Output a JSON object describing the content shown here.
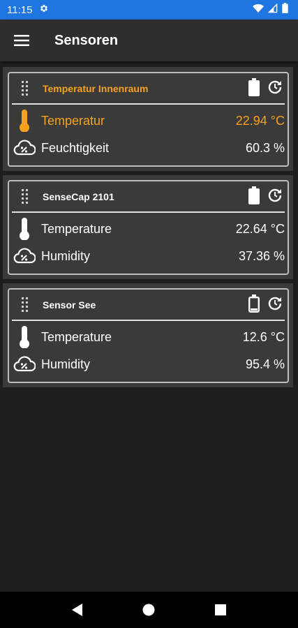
{
  "status_bar": {
    "time": "11:15",
    "icons": [
      "gear-icon",
      "wifi-icon",
      "cellular-icon",
      "battery-icon"
    ]
  },
  "app_bar": {
    "title": "Sensoren",
    "menu_icon": "hamburger-menu-icon"
  },
  "colors": {
    "status_bar": "#2076e0",
    "app_bar": "#2e2e2e",
    "background": "#1e1e1e",
    "card": "#3a3a3a",
    "accent": "#f7a21e",
    "text": "#ffffff"
  },
  "sensors": [
    {
      "name": "Temperatur Innenraum",
      "highlight": true,
      "battery": "full",
      "rows": [
        {
          "icon": "thermometer-icon",
          "label": "Temperatur",
          "value": "22.94 °C",
          "highlight": true
        },
        {
          "icon": "humidity-cloud-icon",
          "label": "Feuchtigkeit",
          "value": "60.3 %",
          "highlight": false
        }
      ]
    },
    {
      "name": "SenseCap 2101",
      "highlight": false,
      "battery": "full",
      "rows": [
        {
          "icon": "thermometer-icon",
          "label": "Temperature",
          "value": "22.64 °C",
          "highlight": false
        },
        {
          "icon": "humidity-cloud-icon",
          "label": "Humidity",
          "value": "37.36 %",
          "highlight": false
        }
      ]
    },
    {
      "name": "Sensor See",
      "highlight": false,
      "battery": "low",
      "rows": [
        {
          "icon": "thermometer-icon",
          "label": "Temperature",
          "value": "12.6 °C",
          "highlight": false
        },
        {
          "icon": "humidity-cloud-icon",
          "label": "Humidity",
          "value": "95.4 %",
          "highlight": false
        }
      ]
    }
  ],
  "nav_bar": {
    "buttons": [
      "back-icon",
      "home-icon",
      "recents-icon"
    ]
  }
}
